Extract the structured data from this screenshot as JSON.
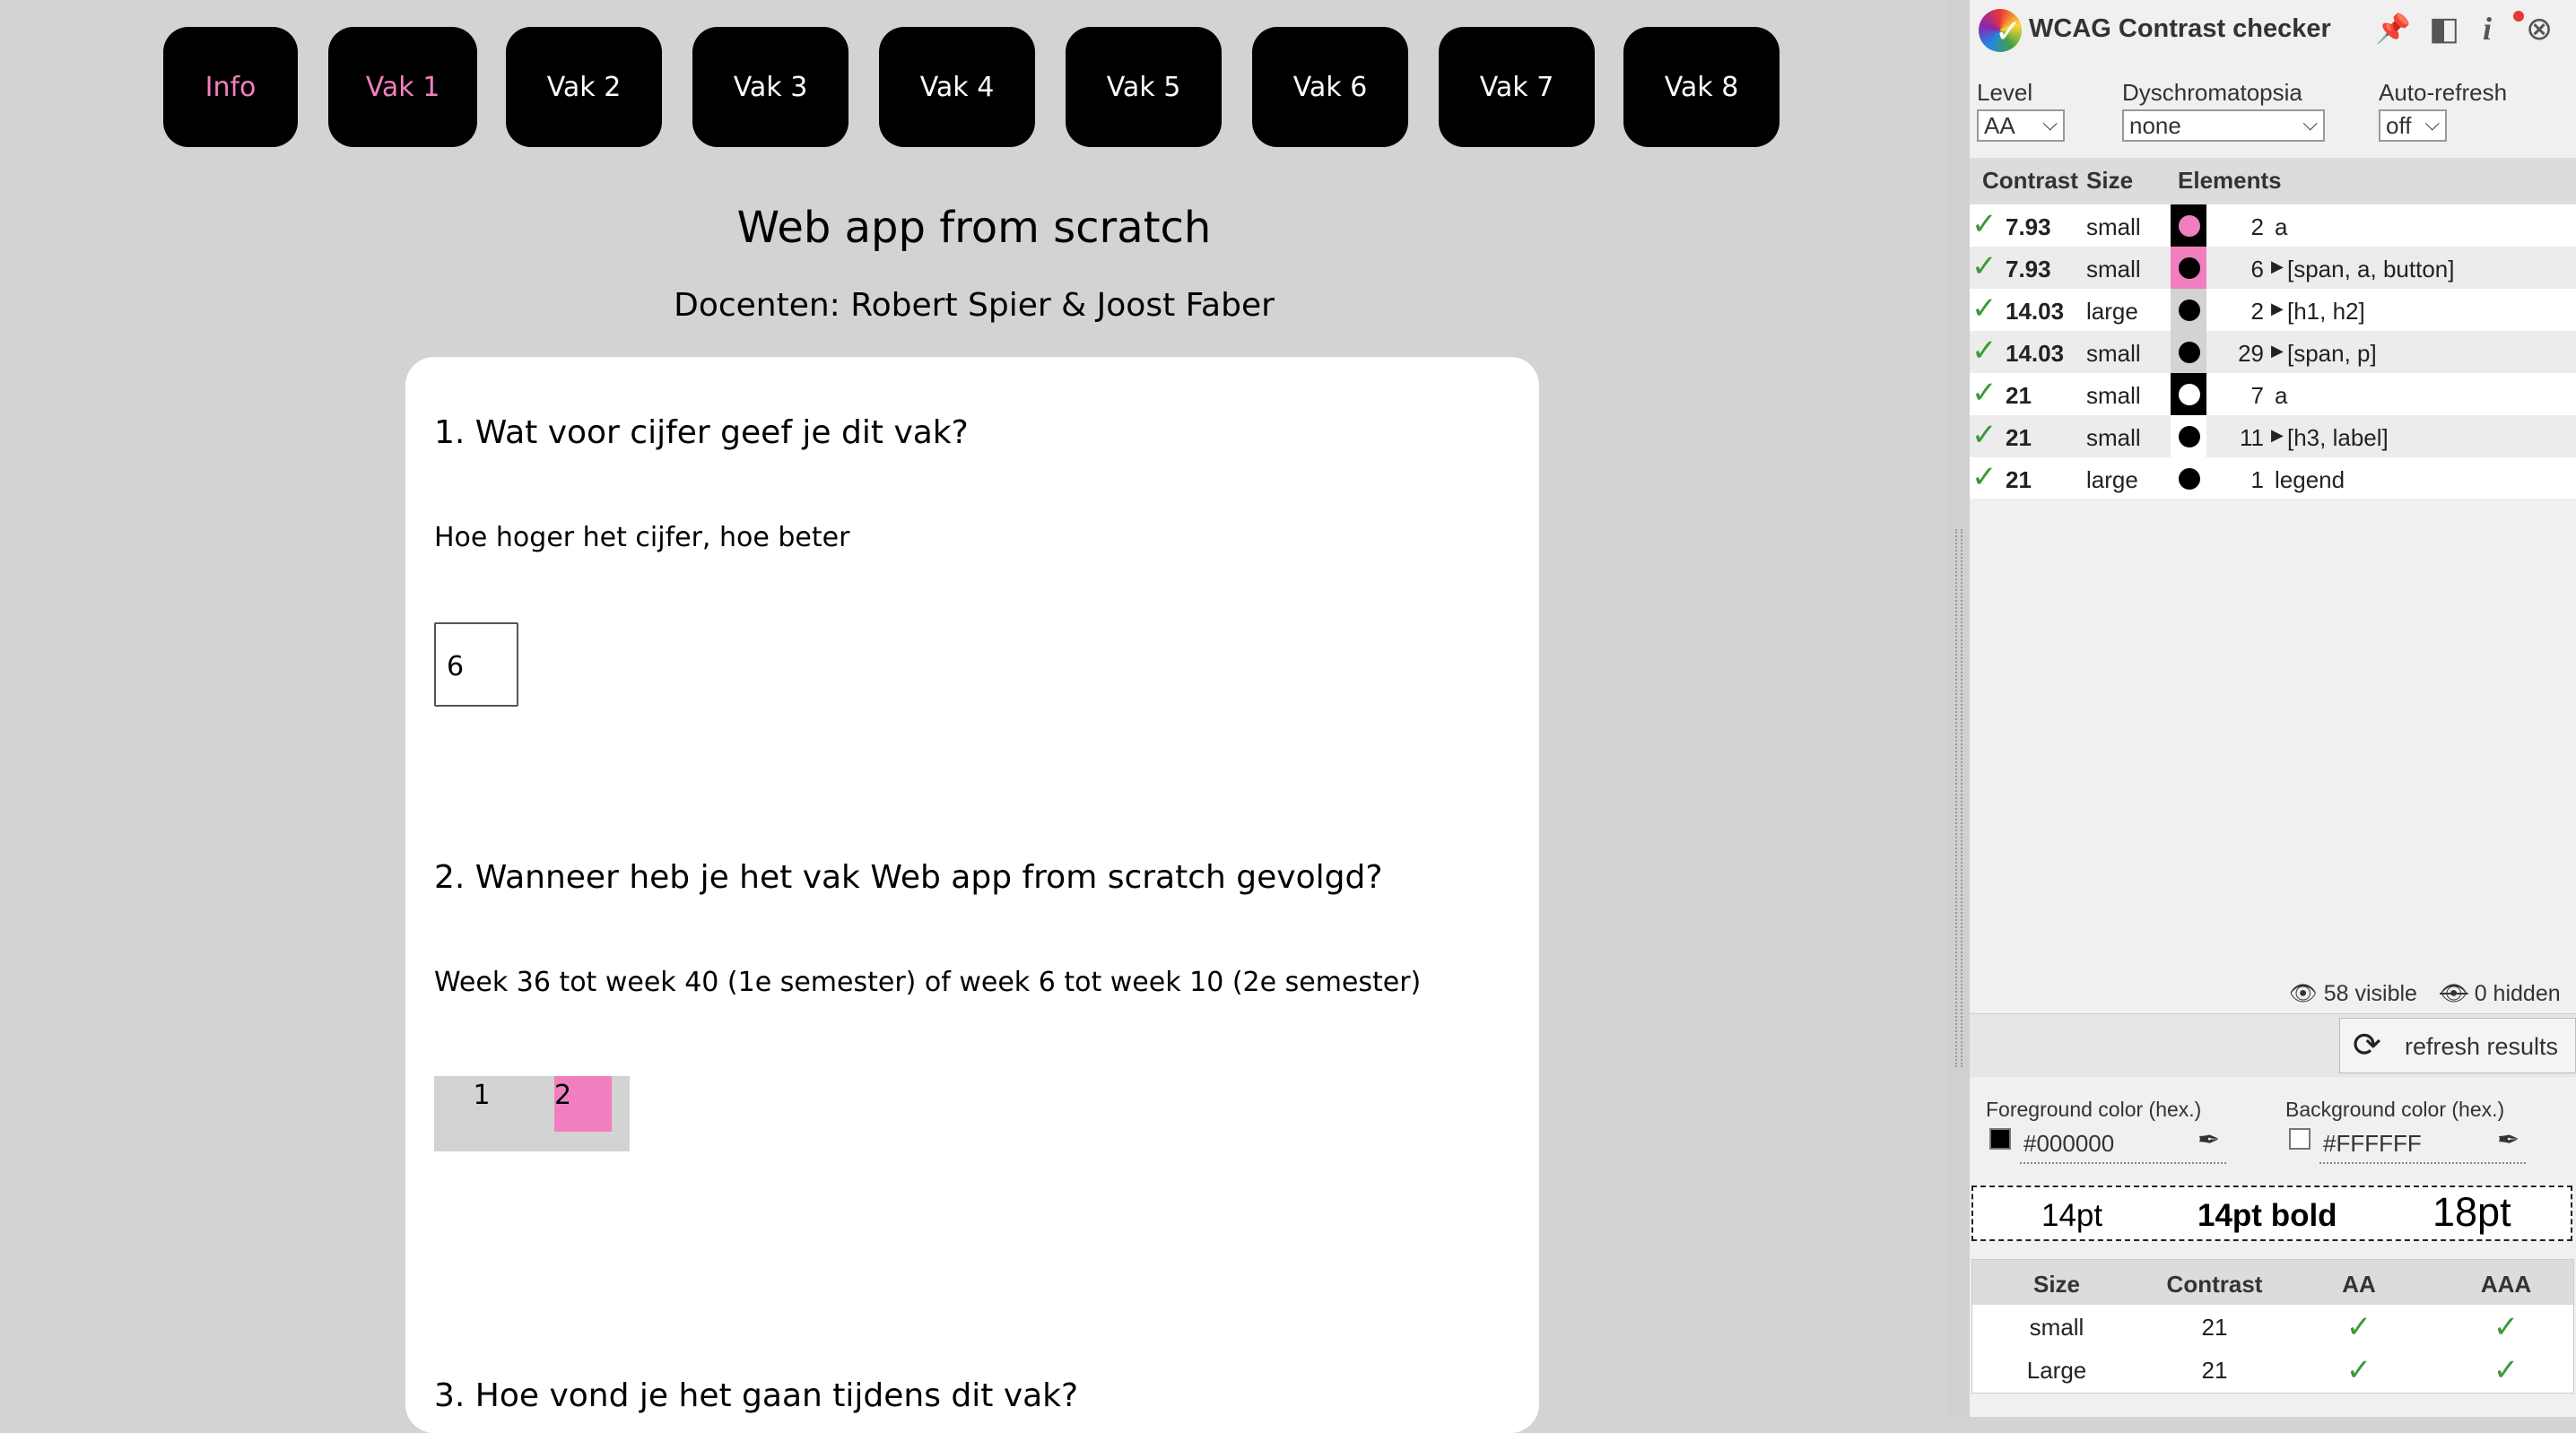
{
  "nav": {
    "tabs": [
      {
        "label": "Info",
        "active": true
      },
      {
        "label": "Vak 1",
        "active": true
      },
      {
        "label": "Vak 2",
        "active": false
      },
      {
        "label": "Vak 3",
        "active": false
      },
      {
        "label": "Vak 4",
        "active": false
      },
      {
        "label": "Vak 5",
        "active": false
      },
      {
        "label": "Vak 6",
        "active": false
      },
      {
        "label": "Vak 7",
        "active": false
      },
      {
        "label": "Vak 8",
        "active": false
      }
    ]
  },
  "page": {
    "title": "Web app from scratch",
    "subtitle": "Docenten: Robert Spier & Joost Faber",
    "accent_color": "#f17fbf"
  },
  "form": {
    "q1": {
      "title": "1. Wat voor cijfer geef je dit vak?",
      "hint": "Hoe hoger het cijfer, hoe beter",
      "value": "6"
    },
    "q2": {
      "title": "2. Wanneer heb je het vak Web app from scratch gevolgd?",
      "hint": "Week 36 tot week 40 (1e semester) of week 6 tot week 10 (2e semester)",
      "options": [
        "1",
        "2"
      ],
      "selected": "2"
    },
    "q3": {
      "title": "3. Hoe vond je het gaan tijdens dit vak?"
    }
  },
  "panel": {
    "title": "WCAG Contrast checker",
    "controls": {
      "level": {
        "label": "Level",
        "value": "AA"
      },
      "dyschromatopsia": {
        "label": "Dyschromatopsia",
        "value": "none"
      },
      "auto_refresh": {
        "label": "Auto-refresh",
        "value": "off"
      }
    },
    "table_headers": {
      "contrast": "Contrast",
      "size": "Size",
      "elements": "Elements"
    },
    "rows": [
      {
        "contrast": "7.93",
        "size": "small",
        "count": "2",
        "elements": "a",
        "expandable": false,
        "swatch_bg": "#000000",
        "swatch_fg": "#f17fbf"
      },
      {
        "contrast": "7.93",
        "size": "small",
        "count": "6",
        "elements": "[span, a, button]",
        "expandable": true,
        "swatch_bg": "#f17fbf",
        "swatch_fg": "#000000"
      },
      {
        "contrast": "14.03",
        "size": "large",
        "count": "2",
        "elements": "[h1, h2]",
        "expandable": true,
        "swatch_bg": "#d3d3d3",
        "swatch_fg": "#000000"
      },
      {
        "contrast": "14.03",
        "size": "small",
        "count": "29",
        "elements": "[span, p]",
        "expandable": true,
        "swatch_bg": "#d3d3d3",
        "swatch_fg": "#000000"
      },
      {
        "contrast": "21",
        "size": "small",
        "count": "7",
        "elements": "a",
        "expandable": false,
        "swatch_bg": "#000000",
        "swatch_fg": "#ffffff"
      },
      {
        "contrast": "21",
        "size": "small",
        "count": "11",
        "elements": "[h3, label]",
        "expandable": true,
        "swatch_bg": "#ffffff",
        "swatch_fg": "#000000"
      },
      {
        "contrast": "21",
        "size": "large",
        "count": "1",
        "elements": "legend",
        "expandable": false,
        "swatch_bg": "#ffffff",
        "swatch_fg": "#000000"
      }
    ],
    "stats": {
      "visible": "58 visible",
      "hidden": "0 hidden"
    },
    "refresh_label": "refresh results",
    "foreground": {
      "label": "Foreground color (hex.)",
      "value": "#000000"
    },
    "background": {
      "label": "Background color (hex.)",
      "value": "#FFFFFF"
    },
    "size_preview": {
      "a": "14pt",
      "b": "14pt bold",
      "c": "18pt"
    },
    "result": {
      "headers": {
        "size": "Size",
        "contrast": "Contrast",
        "aa": "AA",
        "aaa": "AAA"
      },
      "rows": [
        {
          "size": "small",
          "contrast": "21",
          "aa": "✓",
          "aaa": "✓"
        },
        {
          "size": "Large",
          "contrast": "21",
          "aa": "✓",
          "aaa": "✓"
        }
      ]
    }
  }
}
